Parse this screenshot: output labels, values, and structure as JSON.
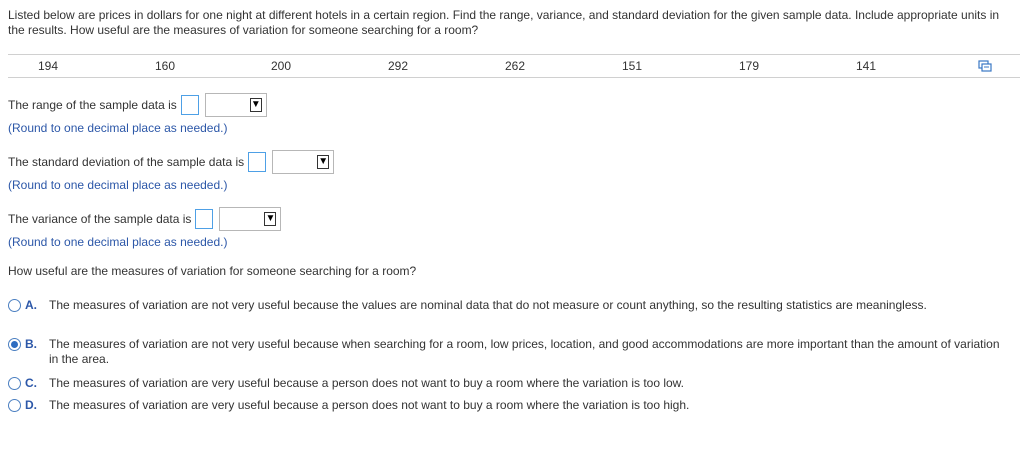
{
  "intro": "Listed below are prices in dollars for one night at different hotels in a certain region. Find the range, variance, and standard deviation for the given sample data. Include appropriate units in the results. How useful are the measures of variation for someone searching for a room?",
  "prices": [
    "194",
    "160",
    "200",
    "292",
    "262",
    "151",
    "179",
    "141"
  ],
  "copy_icon": "copy-data-icon",
  "questions": {
    "range": {
      "label": "The range of the sample data is",
      "value": "",
      "unit": "",
      "hint": "(Round to one decimal place as needed.)"
    },
    "stddev": {
      "label": "The standard deviation of the sample data is",
      "value": "",
      "unit": "",
      "hint": "(Round to one decimal place as needed.)"
    },
    "variance": {
      "label": "The variance of the sample data is",
      "value": "",
      "unit": "",
      "hint": "(Round to one decimal place as needed.)"
    }
  },
  "usefulness_question": "How useful are the measures of variation for someone searching for a room?",
  "options": [
    {
      "letter": "A.",
      "text": "The measures of variation are not very useful because the values are nominal data that do not measure or count anything, so the resulting statistics are meaningless.",
      "selected": false
    },
    {
      "letter": "B.",
      "text": "The measures of variation are not very useful because when searching for a room, low prices, location, and good accommodations are more important than the amount of variation in the area.",
      "selected": true
    },
    {
      "letter": "C.",
      "text": "The measures of variation are very useful because a person does not want to buy a room where the variation is too low.",
      "selected": false
    },
    {
      "letter": "D.",
      "text": "The measures of variation are very useful because a person does not want to buy a room where the variation is too high.",
      "selected": false
    }
  ],
  "colors": {
    "accent": "#2c57a8",
    "input_border": "#4ea0e6",
    "radio_fill": "#2d6cc0"
  }
}
